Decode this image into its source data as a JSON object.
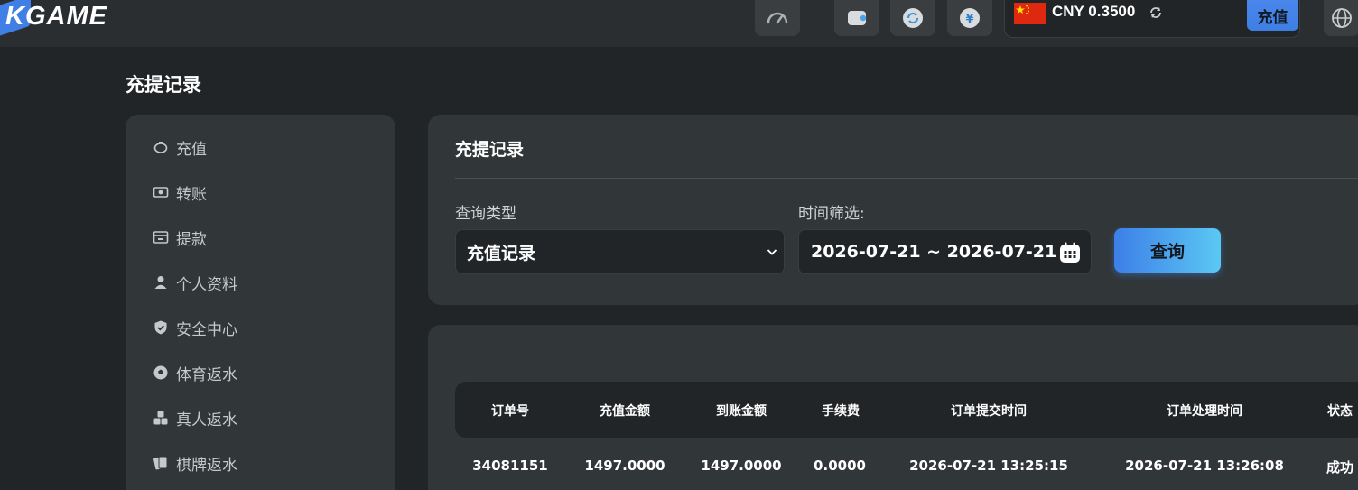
{
  "header": {
    "logo_text": "KGAME",
    "icons": [
      "speedometer-icon",
      "wallet-icon",
      "refresh-icon",
      "yuan-coin-icon",
      "globe-icon"
    ],
    "balance": {
      "flag": "cn-flag",
      "text": "CNY 0.3500",
      "deposit_label": "充值"
    }
  },
  "page_title": "充提记录",
  "sidebar": {
    "items": [
      {
        "label": "充值",
        "icon": "piggy-bank-icon"
      },
      {
        "label": "转账",
        "icon": "money-transfer-icon"
      },
      {
        "label": "提款",
        "icon": "withdraw-icon"
      },
      {
        "label": "个人资料",
        "icon": "user-icon"
      },
      {
        "label": "安全中心",
        "icon": "shield-icon"
      },
      {
        "label": "体育返水",
        "icon": "soccer-ball-icon"
      },
      {
        "label": "真人返水",
        "icon": "dice-icon"
      },
      {
        "label": "棋牌返水",
        "icon": "cards-icon"
      }
    ]
  },
  "filter": {
    "title": "充提记录",
    "type_label": "查询类型",
    "type_value": "充值记录",
    "time_label": "时间筛选:",
    "date_range": "2026-07-21 ~ 2026-07-21",
    "query_label": "查询"
  },
  "table": {
    "columns": [
      "订单号",
      "充值金额",
      "到账金额",
      "手续费",
      "订单提交时间",
      "订单处理时间",
      "状态"
    ],
    "rows": [
      [
        "34081151",
        "1497.0000",
        "1497.0000",
        "0.0000",
        "2026-07-21 13:25:15",
        "2026-07-21 13:26:08",
        "成功"
      ]
    ]
  },
  "colors": {
    "background": "#222527",
    "panel": "#313638",
    "accent": "#3e7fe3",
    "accent_end": "#5bc8f3"
  }
}
